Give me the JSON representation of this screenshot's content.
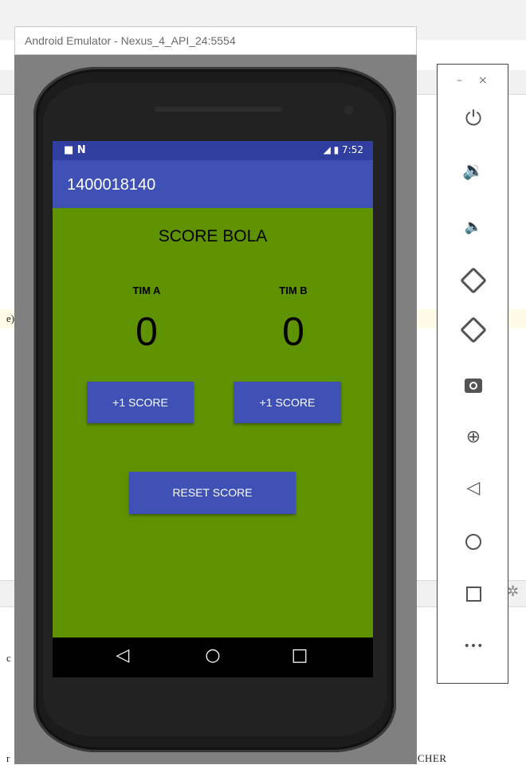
{
  "window": {
    "title": "Android Emulator - Nexus_4_API_24:5554"
  },
  "status_bar": {
    "left_icons": "■ N",
    "time": "7:52",
    "signal_icons": "◢ ▮"
  },
  "app": {
    "title": "1400018140",
    "heading": "SCORE BOLA",
    "team_a": {
      "label": "TIM A",
      "score": "0",
      "button": "+1 SCORE"
    },
    "team_b": {
      "label": "TIM B",
      "score": "0",
      "button": "+1 SCORE"
    },
    "reset_button": "RESET SCORE"
  },
  "nav_bar": {
    "back": "◁",
    "home": "○",
    "recent": "□"
  },
  "toolbar": {
    "minimize": "–",
    "close": "×",
    "power": "⏻",
    "volume_up": "🔉",
    "volume_down": "🔈",
    "zoom": "⊕",
    "back": "◁",
    "more": "•••",
    "icons": [
      "power-icon",
      "volume-up-icon",
      "volume-down-icon",
      "rotate-left-icon",
      "rotate-right-icon",
      "camera-icon",
      "zoom-icon",
      "back-icon",
      "home-icon",
      "overview-icon",
      "more-icon"
    ]
  },
  "ide_background": {
    "bottom_text": "NCHER",
    "left_chars": [
      "e)",
      "c",
      "r"
    ]
  },
  "colors": {
    "app_bar": "#3F51B5",
    "status_bar": "#303F9F",
    "content": "#5F9200",
    "button": "#3F51B5"
  }
}
